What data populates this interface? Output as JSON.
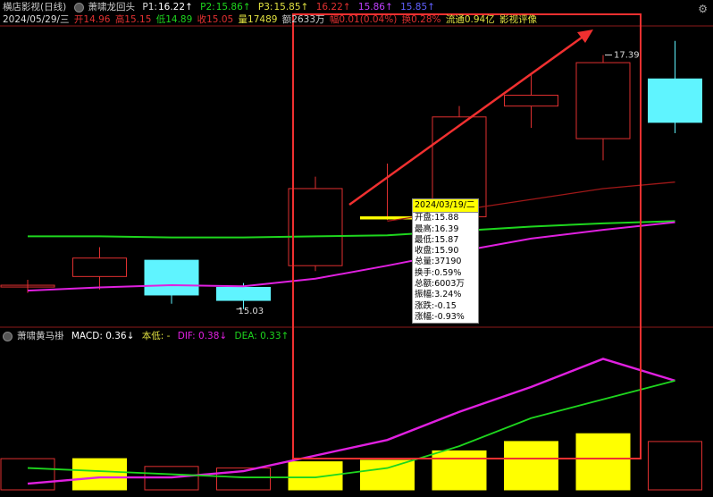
{
  "header": {
    "title": "横店影视(日线)",
    "indicator_name": "萧啸龙回头",
    "p1_label": "P1:",
    "p1_value": "16.22↑",
    "p2_label": "P2:",
    "p2_value": "15.86↑",
    "p3_label": "P3:",
    "p3_value": "15.85↑",
    "v4": "16.22↑",
    "v5": "15.86↑",
    "v6": "15.85↑"
  },
  "quote": {
    "date": "2024/05/29/三",
    "open": "开14.96",
    "high": "高15.15",
    "low": "低14.89",
    "close": "收15.05",
    "volume": "量17489",
    "amount": "额2633万",
    "amp": "幅0.01(0.04%)",
    "turnover": "换0.28%",
    "float": "流通0.94亿",
    "sector": "影视评像"
  },
  "tooltip": {
    "date": "2024/03/19/二",
    "rows": [
      "开盘:15.88",
      "最高:16.39",
      "最低:15.87",
      "收盘:15.90",
      "总量:37190",
      "换手:0.59%",
      "总额:6003万",
      "振幅:3.24%",
      "涨跌:-0.15",
      "涨幅:-0.93%"
    ]
  },
  "annotations": {
    "high_label": "17.39",
    "low_label": "15.03"
  },
  "macd_header": {
    "name": "萧啸黄马褂",
    "macd": "MACD: 0.36↓",
    "base": "本低: -",
    "dif": "DIF: 0.38↓",
    "dea": "DEA: 0.33↑"
  },
  "colors": {
    "up": "#e03030",
    "down": "#5ff4ff",
    "yellow": "#ffff00",
    "ma_green": "#1ed61e",
    "ma_magenta": "#e020e0",
    "ma_red": "#a01818",
    "ma_gray": "#bbbbbb",
    "box": "#f03030",
    "axis": "#8b1a1a"
  },
  "chart_data": [
    {
      "type": "candlestick",
      "title": "横店影视(日线)",
      "x": [
        "c0",
        "c1",
        "c2",
        "c3",
        "c4",
        "c5",
        "c6",
        "c7",
        "c8",
        "c9"
      ],
      "ohlc": [
        [
          15.27,
          15.32,
          15.2,
          15.27
        ],
        [
          15.35,
          15.62,
          15.23,
          15.52
        ],
        [
          15.5,
          15.5,
          15.1,
          15.18
        ],
        [
          15.25,
          15.29,
          15.05,
          15.13
        ],
        [
          15.45,
          16.27,
          15.4,
          16.16
        ],
        [
          15.88,
          16.39,
          15.87,
          15.9
        ],
        [
          15.9,
          16.92,
          15.7,
          16.82
        ],
        [
          16.92,
          17.22,
          16.72,
          17.02
        ],
        [
          16.62,
          17.39,
          16.42,
          17.32
        ],
        [
          17.17,
          17.52,
          16.67,
          16.77
        ]
      ],
      "ylim": [
        14.9,
        17.65
      ],
      "series": [
        {
          "name": "P1",
          "values": [
            null,
            null,
            null,
            null,
            null,
            15.86,
            15.96,
            16.06,
            16.16,
            16.22
          ]
        },
        {
          "name": "P2",
          "values": [
            15.72,
            15.72,
            15.71,
            15.71,
            15.72,
            15.73,
            15.77,
            15.81,
            15.84,
            15.86
          ]
        },
        {
          "name": "P3",
          "values": [
            15.22,
            15.25,
            15.27,
            15.26,
            15.33,
            15.45,
            15.58,
            15.7,
            15.78,
            15.85
          ]
        }
      ]
    },
    {
      "type": "bar",
      "title": "萧啸黄马褂",
      "x": [
        "c0",
        "c1",
        "c2",
        "c3",
        "c4",
        "c5",
        "c6",
        "c7",
        "c8",
        "c9"
      ],
      "series": [
        {
          "name": "MACD",
          "values": [
            0.08,
            0.08,
            0.055,
            0.05,
            0.07,
            0.075,
            0.105,
            0.135,
            0.16,
            0.135
          ]
        },
        {
          "name": "DIF",
          "values": [
            0.0,
            0.02,
            0.02,
            0.04,
            0.09,
            0.14,
            0.23,
            0.31,
            0.4,
            0.33
          ]
        },
        {
          "name": "DEA",
          "values": [
            0.05,
            0.04,
            0.03,
            0.02,
            0.02,
            0.05,
            0.12,
            0.21,
            0.27,
            0.33
          ]
        }
      ],
      "ylim": [
        -0.02,
        0.45
      ]
    }
  ]
}
